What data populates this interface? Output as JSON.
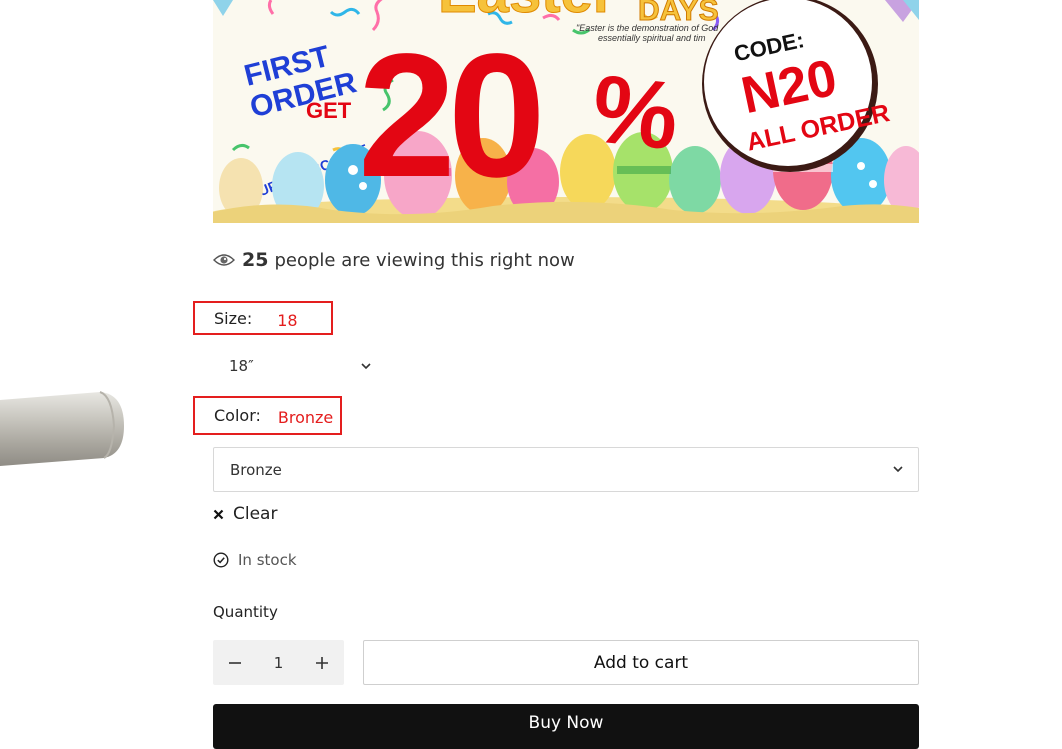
{
  "banner": {
    "headline_partial": "Easter",
    "headline_days": "DAYS",
    "quote_line1": "\"Easter is the demonstration of God",
    "quote_line2": "essentially spiritual and tim",
    "first_order_line1": "FIRST",
    "first_order_line2": "ORDER",
    "get": "GET",
    "super_discount": "SUPER DISCOUNT",
    "big_number": "20",
    "percent": "%",
    "code_label": "CODE:",
    "code_value": "N20",
    "all_order": "ALL ORDER",
    "colors": {
      "red": "#e30613",
      "blue": "#1f3fd6",
      "orange": "#ff8a1e",
      "badge": "#ffffff"
    }
  },
  "viewers": {
    "count": "25",
    "text": "people are viewing this right now"
  },
  "size": {
    "label": "Size:",
    "selected_value": "18",
    "dropdown_value": "18″"
  },
  "color": {
    "label": "Color:",
    "selected_value": "Bronze",
    "dropdown_value": "Bronze"
  },
  "clear_label": "Clear",
  "stock_status": "In stock",
  "quantity": {
    "label": "Quantity",
    "value": "1"
  },
  "add_to_cart_label": "Add to cart",
  "buy_now_label": "Buy Now",
  "accent_color": "#e41e1e"
}
